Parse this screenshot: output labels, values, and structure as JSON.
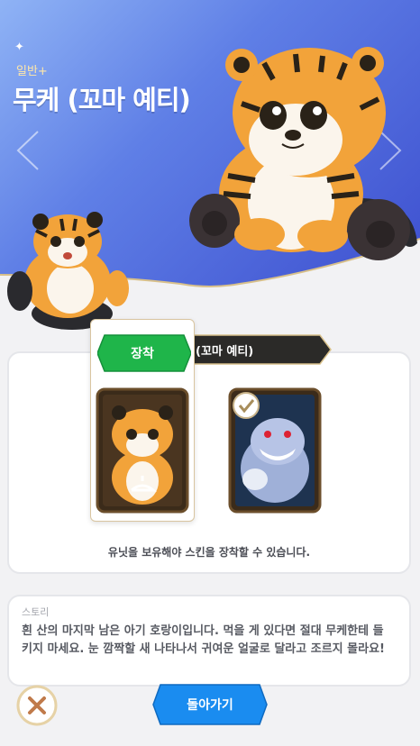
{
  "header": {
    "sparkle_icon": "✦",
    "rarity": "일반+",
    "skin_name": "무케 (꼬마 예티)"
  },
  "skins": {
    "name_ribbon": "(꼬마 예티)",
    "equip_label": "장착",
    "notice": "유닛을 보유해야 스킨을 장착할 수 있습니다."
  },
  "story": {
    "label": "스토리",
    "text": "흰 산의 마지막 남은 아기 호랑이입니다. 먹을 게 있다면 절대 무케한테 들키지 마세요. 눈 깜짝할 새 나타나서 귀여운 얼굴로 달라고 조르지 몰라요!"
  },
  "footer": {
    "back_label": "돌아가기"
  },
  "colors": {
    "hero_start": "#8fb3f5",
    "hero_end": "#3d4fcf",
    "equip_green": "#1fb54a",
    "back_blue": "#1a8cf0",
    "ribbon_dark": "#2b2a28"
  }
}
